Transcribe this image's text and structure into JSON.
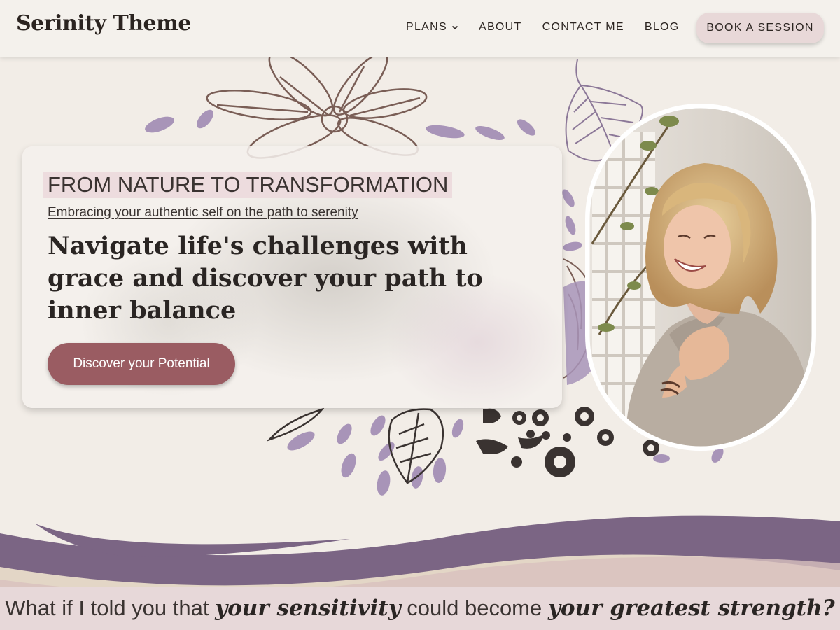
{
  "header": {
    "logo": "Serinity Theme",
    "nav": [
      {
        "label": "PLANS",
        "has_dropdown": true
      },
      {
        "label": "ABOUT"
      },
      {
        "label": "CONTACT ME"
      },
      {
        "label": "BLOG"
      }
    ],
    "book_button": "BOOK A SESSION"
  },
  "hero": {
    "eyebrow": "FROM NATURE TO TRANSFORMATION",
    "subline": "Embracing your authentic self on the path to serenity",
    "headline": "Navigate life's challenges with grace and discover your path to inner balance",
    "cta": "Discover your Potential"
  },
  "band": {
    "part1": "What if I told you that ",
    "em1": "your sensitivity",
    "part2": " could become ",
    "em2": "your greatest strength?"
  },
  "colors": {
    "background": "#f2ede7",
    "accent_rose": "#9a5c62",
    "accent_purple": "#7b6584",
    "lavender": "#a894b8",
    "band": "#e7d8d9"
  },
  "icons": [
    "chevron-down-icon",
    "flower-illustration",
    "leaf-illustration",
    "dots-illustration"
  ]
}
